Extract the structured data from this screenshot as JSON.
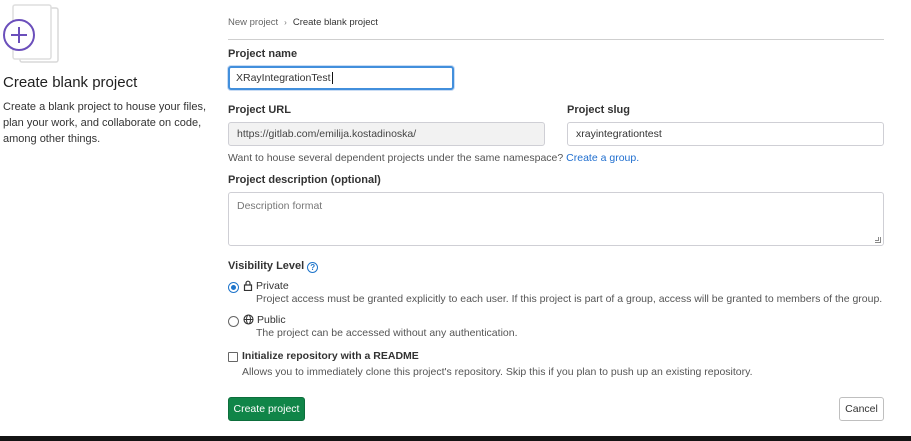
{
  "sidebar": {
    "title": "Create blank project",
    "description": "Create a blank project to house your files, plan your work, and collaborate on code, among other things."
  },
  "breadcrumb": {
    "items": [
      "New project",
      "Create blank project"
    ]
  },
  "form": {
    "project_name": {
      "label": "Project name",
      "value": "XRayIntegrationTest"
    },
    "project_url": {
      "label": "Project URL",
      "value": "https://gitlab.com/emilija.kostadinoska/"
    },
    "project_slug": {
      "label": "Project slug",
      "value": "xrayintegrationtest"
    },
    "namespace_help": {
      "text": "Want to house several dependent projects under the same namespace?",
      "link": "Create a group."
    },
    "description": {
      "label": "Project description (optional)",
      "placeholder": "Description format"
    },
    "visibility": {
      "label": "Visibility Level",
      "options": [
        {
          "title": "Private",
          "icon": "lock-icon",
          "checked": true,
          "description": "Project access must be granted explicitly to each user. If this project is part of a group, access will be granted to members of the group."
        },
        {
          "title": "Public",
          "icon": "globe-icon",
          "checked": false,
          "description": "The project can be accessed without any authentication."
        }
      ]
    },
    "readme": {
      "label": "Initialize repository with a README",
      "checked": false,
      "description": "Allows you to immediately clone this project's repository. Skip this if you plan to push up an existing repository."
    }
  },
  "actions": {
    "create_label": "Create project",
    "cancel_label": "Cancel"
  },
  "colors": {
    "primary_button": "#108548",
    "link": "#1f6ecf",
    "focus": "#428fdc",
    "illustration_accent": "#6b4fbb"
  }
}
